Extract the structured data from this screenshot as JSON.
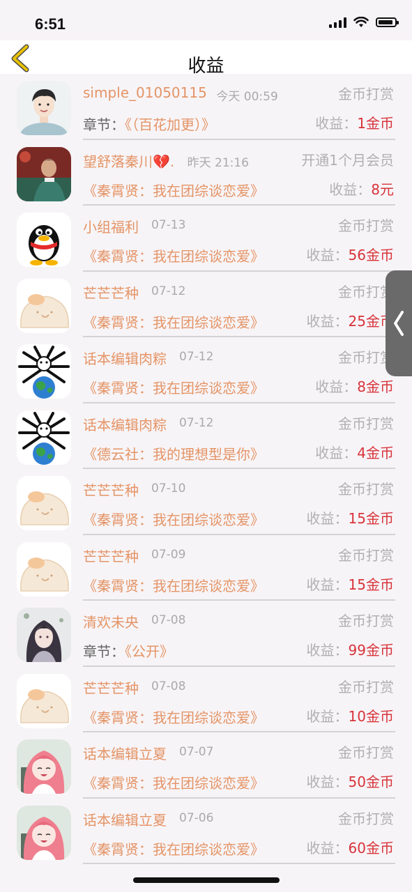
{
  "status_bar": {
    "time": "6:51"
  },
  "nav": {
    "title": "收益"
  },
  "rows": [
    {
      "name": "simple_01050115",
      "time": "今天 00:59",
      "type": "金币打赏",
      "book_prefix": "章节：",
      "book": "《（百花加更）》",
      "income_label": "收益：",
      "amount": "1金币",
      "avatar": "boy-portrait"
    },
    {
      "name": "望舒落秦川💔.",
      "time": "昨天 21:16",
      "type": "开通1个月会员",
      "book_prefix": "",
      "book": "《秦霄贤：我在团综谈恋爱》",
      "income_label": "收益：",
      "amount": "8元",
      "avatar": "singer-photo"
    },
    {
      "name": "小组福利",
      "time": "07-13",
      "type": "金币打赏",
      "book_prefix": "",
      "book": "《秦霄贤：我在团综谈恋爱》",
      "income_label": "收益：",
      "amount": "56金币",
      "avatar": "qq-penguin"
    },
    {
      "name": "芒芒芒种",
      "time": "07-12",
      "type": "金币打赏",
      "book_prefix": "",
      "book": "《秦霄贤：我在团综谈恋爱》",
      "income_label": "收益：",
      "amount": "25金币",
      "avatar": "bun-cartoon"
    },
    {
      "name": "话本编辑肉粽",
      "time": "07-12",
      "type": "金币打赏",
      "book_prefix": "",
      "book": "《秦霄贤：我在团综谈恋爱》",
      "income_label": "收益：",
      "amount": "8金币",
      "avatar": "spider-globe"
    },
    {
      "name": "话本编辑肉粽",
      "time": "07-12",
      "type": "金币打赏",
      "book_prefix": "",
      "book": "《德云社：我的理想型是你》",
      "income_label": "收益：",
      "amount": "4金币",
      "avatar": "spider-globe"
    },
    {
      "name": "芒芒芒种",
      "time": "07-10",
      "type": "金币打赏",
      "book_prefix": "",
      "book": "《秦霄贤：我在团综谈恋爱》",
      "income_label": "收益：",
      "amount": "15金币",
      "avatar": "bun-cartoon"
    },
    {
      "name": "芒芒芒种",
      "time": "07-09",
      "type": "金币打赏",
      "book_prefix": "",
      "book": "《秦霄贤：我在团综谈恋爱》",
      "income_label": "收益：",
      "amount": "15金币",
      "avatar": "bun-cartoon"
    },
    {
      "name": "清欢未央",
      "time": "07-08",
      "type": "金币打赏",
      "book_prefix": "章节：",
      "book": "《公开》",
      "income_label": "收益：",
      "amount": "99金币",
      "avatar": "anime-girl"
    },
    {
      "name": "芒芒芒种",
      "time": "07-08",
      "type": "金币打赏",
      "book_prefix": "",
      "book": "《秦霄贤：我在团综谈恋爱》",
      "income_label": "收益：",
      "amount": "10金币",
      "avatar": "bun-cartoon"
    },
    {
      "name": "话本编辑立夏",
      "time": "07-07",
      "type": "金币打赏",
      "book_prefix": "",
      "book": "《秦霄贤：我在团综谈恋爱》",
      "income_label": "收益：",
      "amount": "50金币",
      "avatar": "pink-hair-girl"
    },
    {
      "name": "话本编辑立夏",
      "time": "07-06",
      "type": "金币打赏",
      "book_prefix": "",
      "book": "《秦霄贤：我在团综谈恋爱》",
      "income_label": "收益：",
      "amount": "60金币",
      "avatar": "pink-hair-girl"
    }
  ],
  "colors": {
    "name": "#e49466",
    "amount": "#d7333a",
    "muted": "#b0b0b0",
    "back": "#e6c000"
  }
}
